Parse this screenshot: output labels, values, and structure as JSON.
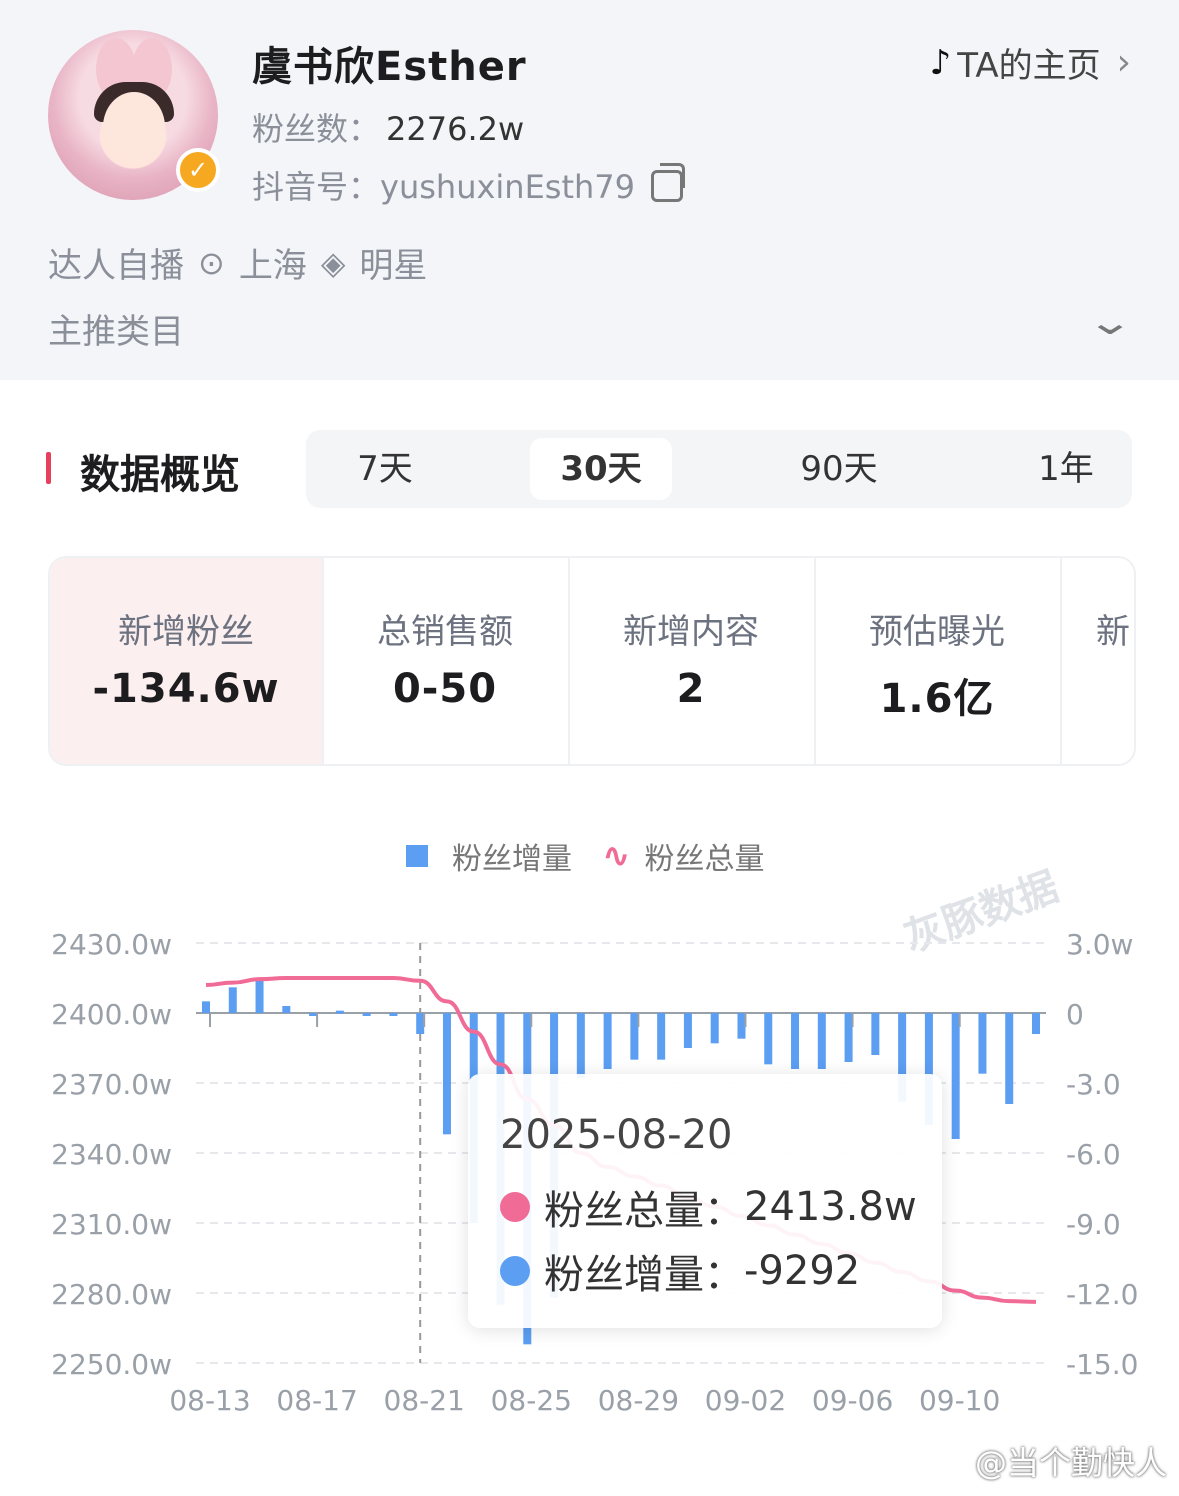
{
  "profile": {
    "name": "虞书欣Esther",
    "home_link": "TA的主页",
    "fans_label": "粉丝数：",
    "fans_value": "2276.2w",
    "douyin_label": "抖音号：",
    "douyin_value": "yushuxinEsth79",
    "tag_type": "达人自播",
    "tag_location": "上海",
    "tag_role": "明星",
    "category_label": "主推类目"
  },
  "overview": {
    "title": "数据概览",
    "tabs": [
      "7天",
      "30天",
      "90天",
      "1年"
    ],
    "active_tab": "30天"
  },
  "kpis": [
    {
      "label": "新增粉丝",
      "value": "-134.6w"
    },
    {
      "label": "总销售额",
      "value": "0-50"
    },
    {
      "label": "新增内容",
      "value": "2"
    },
    {
      "label": "预估曝光",
      "value": "1.6亿"
    },
    {
      "label": "新",
      "value": ""
    }
  ],
  "legend": {
    "bar": "粉丝增量",
    "line": "粉丝总量"
  },
  "watermark": "灰豚数据",
  "tooltip": {
    "date": "2025-08-20",
    "total_label": "粉丝总量：",
    "total_value": "2413.8w",
    "delta_label": "粉丝增量：",
    "delta_value": "-9292"
  },
  "footer_watermark": "@当个勤快人",
  "colors": {
    "bar": "#5b9ef2",
    "line": "#f16b97",
    "accent": "#e7405c"
  },
  "chart_data": {
    "type": "bar",
    "x_ticks": [
      "08-13",
      "08-17",
      "08-21",
      "08-25",
      "08-29",
      "09-02",
      "09-06",
      "09-10"
    ],
    "left_axis_labels": [
      "2430.0w",
      "2400.0w",
      "2370.0w",
      "2340.0w",
      "2310.0w",
      "2280.0w",
      "2250.0w"
    ],
    "right_axis_labels": [
      "3.0w",
      "0",
      "-3.0",
      "-6.0",
      "-9.0",
      "-12.0",
      "-15.0"
    ],
    "ylim_left": [
      2250,
      2430
    ],
    "ylim_right": [
      -15,
      3
    ],
    "series": [
      {
        "name": "粉丝增量",
        "unit": "w",
        "values": [
          0.5,
          1.1,
          1.4,
          0.3,
          -0.1,
          0.1,
          0.0,
          -0.05,
          -0.9,
          -5.2,
          -9.0,
          -12.5,
          -14.2,
          -12.2,
          -2.8,
          -2.4,
          -2.0,
          -2.0,
          -1.5,
          -1.3,
          -1.1,
          -2.2,
          -2.4,
          -2.4,
          -2.1,
          -1.8,
          -3.8,
          -4.8,
          -5.4,
          -2.6,
          -3.9,
          -0.9
        ]
      },
      {
        "name": "粉丝总量",
        "unit": "w",
        "values": [
          2412,
          2413,
          2414.5,
          2415,
          2415,
          2415,
          2415,
          2415,
          2413.8,
          2405,
          2392,
          2378,
          2363,
          2352,
          2340,
          2334,
          2330,
          2326,
          2321,
          2317,
          2313,
          2309,
          2305,
          2301,
          2297,
          2293,
          2289,
          2285,
          2281,
          2278,
          2276.5,
          2276.2
        ]
      }
    ],
    "highlight_index": 8,
    "grid": true
  }
}
